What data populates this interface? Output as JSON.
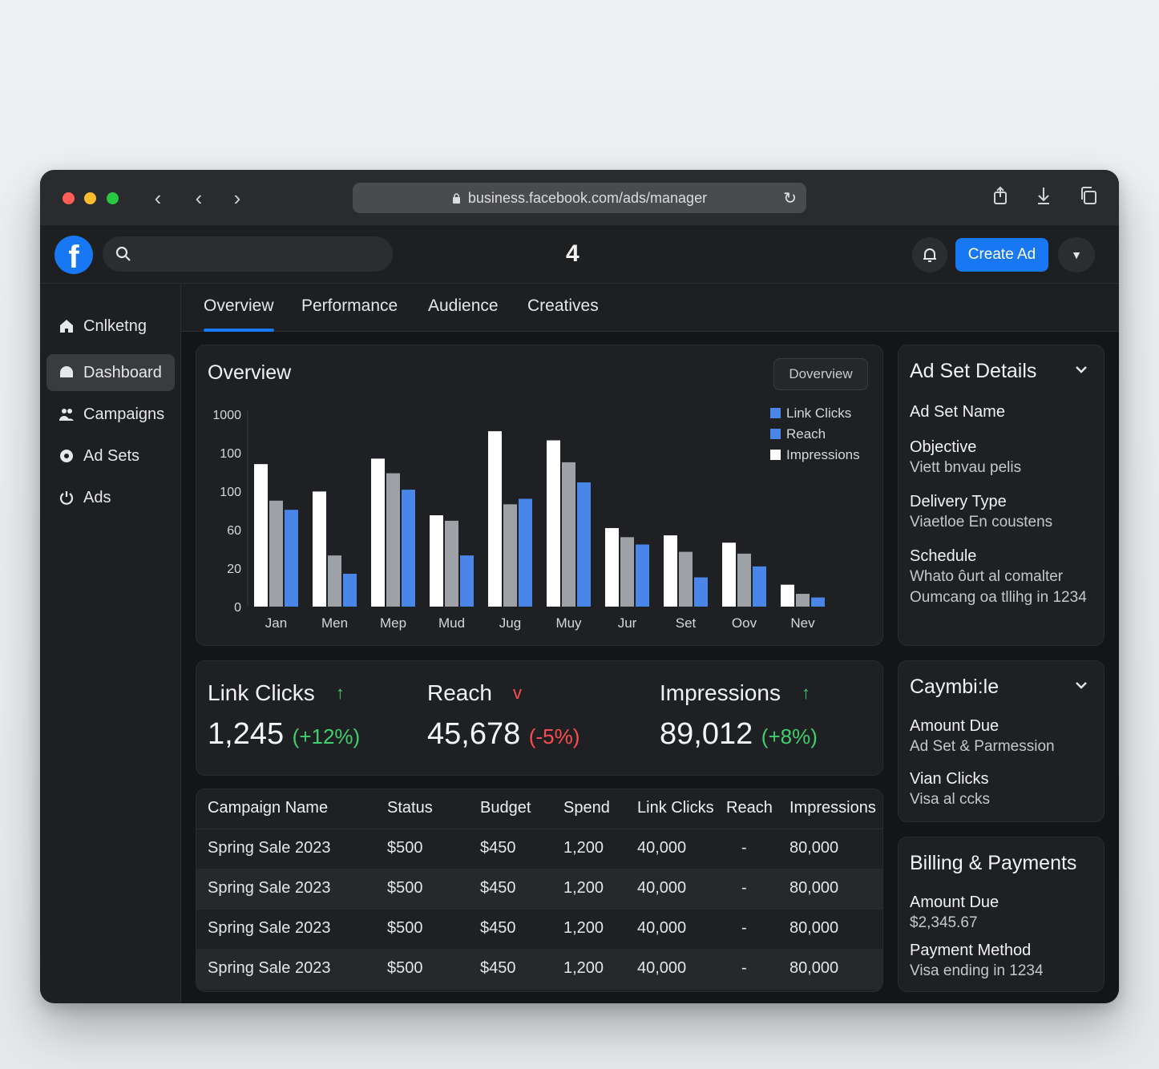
{
  "browser": {
    "url": "business.facebook.com/ads/manager"
  },
  "header": {
    "logo_letter": "f",
    "center_logo": "4",
    "create_label": "Create Ad"
  },
  "sidebar": {
    "items": [
      {
        "label": "Cnlketng",
        "icon": "home-icon"
      },
      {
        "label": "Dashboard",
        "icon": "dashboard-icon"
      },
      {
        "label": "Campaigns",
        "icon": "campaigns-icon"
      },
      {
        "label": "Ad Sets",
        "icon": "circle-icon"
      },
      {
        "label": "Ads",
        "icon": "power-icon"
      }
    ]
  },
  "tabs": [
    "Overview",
    "Performance",
    "Audience",
    "Creatives"
  ],
  "overview": {
    "title": "Overview",
    "button_label": "Doverview"
  },
  "chart_data": {
    "type": "bar",
    "categories": [
      "Jan",
      "Men",
      "Mep",
      "Mud",
      "Jug",
      "Muy",
      "Jur",
      "Set",
      "Oov",
      "Nev"
    ],
    "y_tick_labels": [
      "1000",
      "100",
      "100",
      "60",
      "20",
      "0"
    ],
    "legend_position": "top-right",
    "series": [
      {
        "name": "Impressions",
        "color": "#ffffff",
        "values": [
          78,
          63,
          81,
          50,
          96,
          91,
          43,
          39,
          35,
          12
        ]
      },
      {
        "name": "Reach",
        "color": "#9ea1a6",
        "values": [
          58,
          28,
          73,
          47,
          56,
          79,
          38,
          30,
          29,
          7
        ]
      },
      {
        "name": "Link Clicks",
        "color": "#4a86e8",
        "values": [
          53,
          18,
          64,
          28,
          59,
          68,
          34,
          16,
          22,
          5
        ]
      }
    ],
    "legend": [
      "Link Clicks",
      "Reach",
      "Impressions"
    ],
    "ylim": [
      0,
      100
    ]
  },
  "stats": [
    {
      "label": "Link Clicks",
      "value": "1,245",
      "delta": "(+12%)",
      "trend": "up",
      "arrow": "↑"
    },
    {
      "label": "Reach",
      "value": "45,678",
      "delta": "(-5%)",
      "trend": "down",
      "arrow": "v"
    },
    {
      "label": "Impressions",
      "value": "89,012",
      "delta": "(+8%)",
      "trend": "up",
      "arrow": "↑"
    }
  ],
  "table": {
    "columns": [
      "Campaign Name",
      "Status",
      "Budget",
      "Spend",
      "Link Clicks",
      "Reach",
      "Impressions"
    ],
    "rows": [
      [
        "Spring Sale 2023",
        "$500",
        "$450",
        "1,200",
        "40,000",
        "-",
        "80,000"
      ],
      [
        "Spring Sale 2023",
        "$500",
        "$450",
        "1,200",
        "40,000",
        "-",
        "80,000"
      ],
      [
        "Spring Sale 2023",
        "$500",
        "$450",
        "1,200",
        "40,000",
        "-",
        "80,000"
      ],
      [
        "Spring Sale 2023",
        "$500",
        "$450",
        "1,200",
        "40,000",
        "-",
        "80,000"
      ]
    ]
  },
  "ad_set_details": {
    "title": "Ad Set Details",
    "name_label": "Ad Set Name",
    "objective_label": "Objective",
    "objective_value": "Viett bnvau pelis",
    "delivery_label": "Delivery Type",
    "delivery_value": "Viaetloe En coustens",
    "schedule_label": "Schedule",
    "schedule_value": "Whato ôurt al comalter Oumcang oa tllihg in 1234"
  },
  "caymbile": {
    "title": "Caymbi:le",
    "amount_label": "Amount Due",
    "amount_value": "Ad Set & Parmession",
    "clicks_label": "Vian Clicks",
    "clicks_value": "Visa al ccks"
  },
  "billing": {
    "title": "Billing & Payments",
    "amount_label": "Amount Due",
    "amount_value": "$2,345.67",
    "method_label": "Payment Method",
    "method_value": "Visa ending in 1234"
  }
}
